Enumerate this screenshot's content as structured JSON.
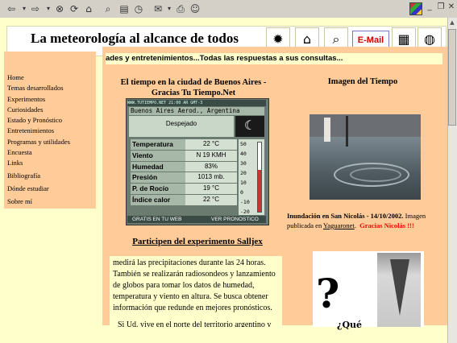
{
  "site": {
    "title": "La meteorología al alcance de todos",
    "email_label": "E-Mail"
  },
  "sidebar": {
    "items": [
      "Home",
      "Temas desarrollados",
      "Experimentos",
      "Curiosidades",
      "Estado y Pronóstico",
      "Entretenimientos",
      "Programas y utilidades",
      "Encuesta",
      "Links",
      "Bibliografía",
      "Dónde estudiar",
      "Sobre mí"
    ]
  },
  "marquee": "ades y entretenimientos...Todas las respuestas a sus consultas...",
  "weather": {
    "heading": "El tiempo en la ciudad de Buenos Aires - Gracias Tu Tiempo.Net",
    "top_banner": "WWW.TUTIEMPO.NET        21:00 AR GMT-3",
    "station": "Buenos Aires Aerod., Argentina",
    "condition": "Despejado",
    "rows": [
      {
        "label": "Temperatura",
        "value": "22 °C"
      },
      {
        "label": "Viento",
        "value": "N 19 KMH"
      },
      {
        "label": "Humedad",
        "value": "83%"
      },
      {
        "label": "Presión",
        "value": "1013 mb."
      },
      {
        "label": "P. de Rocío",
        "value": "19 °C"
      },
      {
        "label": "Índice calor",
        "value": "22 °C"
      }
    ],
    "scale": [
      "50",
      "40",
      "30",
      "20",
      "10",
      "0",
      "-10",
      "-20"
    ],
    "thermometer_value": 22,
    "footer_left": "GRATIS EN TU WEB",
    "footer_right": "VER PRONOSTICO"
  },
  "image_section": {
    "heading": "Imagen del Tiempo",
    "caption_bold": "Inundación en San Nicolás - 14/10/2002.",
    "caption_text": " Imagen publicada en ",
    "caption_link": "Yaguaronet",
    "caption_end": ".",
    "caption_thanks": "Gracias Nicolás !!!"
  },
  "experiment": {
    "heading": "Participen del experimento Salljex",
    "paragraph1": "medirá las precipitaciones durante las 24 horas. También se realizarán radiosondeos y lanzamiento de globos para tomar los datos de humedad, temperatura y viento en altura. Se busca obtener información que redunde en mejores pronósticos.",
    "paragraph2": "Si Ud. vive en el norte del territorio argentino y"
  },
  "promo": {
    "text": "¿Qué"
  },
  "colors": {
    "page_bg": "#ffffcc",
    "panel_bg": "#ffcc99",
    "accent_red": "#ff0000"
  }
}
